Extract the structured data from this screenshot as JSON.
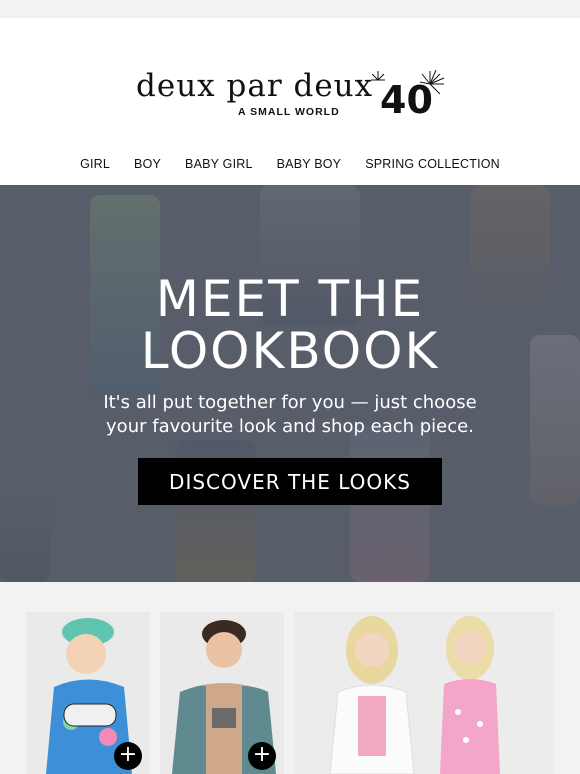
{
  "brand": {
    "name": "deux par deux",
    "tagline": "A SMALL WORLD",
    "anniversary": "40"
  },
  "nav": {
    "items": [
      "GIRL",
      "BOY",
      "BABY GIRL",
      "BABY BOY",
      "SPRING COLLECTION"
    ]
  },
  "hero": {
    "title_line1": "MEET THE",
    "title_line2": "LOOKBOOK",
    "subtitle_line1": "It's all put together for you — just choose",
    "subtitle_line2": "your favourite look and shop each piece.",
    "button_label": "DISCOVER THE LOOKS",
    "background_color": "#575d69"
  },
  "products": {
    "add_icon": "plus-icon"
  }
}
